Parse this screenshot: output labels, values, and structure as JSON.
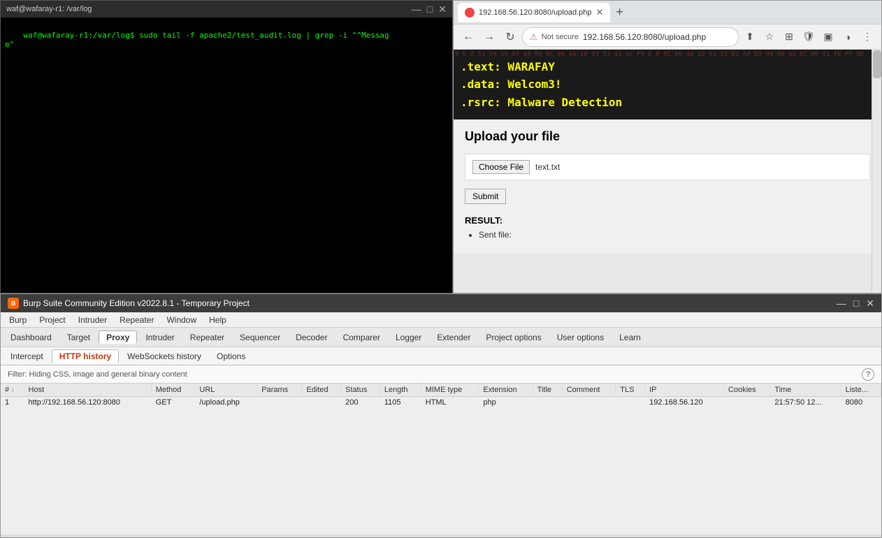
{
  "terminal": {
    "title": "waf@wafaray-r1: /var/log",
    "controls": [
      "—",
      "□",
      "✕"
    ],
    "content": "waf@wafaray-r1:/var/log$ sudo tail -f apache2/test_audit.log | grep -i \"^Messag\ne\""
  },
  "browser": {
    "tab_url": "192.168.56.120:8080/upload.php",
    "tab_close": "✕",
    "new_tab": "+",
    "nav": {
      "back": "←",
      "forward": "→",
      "refresh": "↻",
      "warning": "⚠",
      "not_secure": "Not secure",
      "address": "192.168.56.120:8080...",
      "share": "⬆",
      "bookmark": "☆",
      "extensions": "🧩",
      "profile": "◑",
      "menu": "⋮"
    },
    "hero": {
      "line1": ".text: WARAFAY",
      "line2": ".data: Welcom3!",
      "line3": ".rsrc: Malware Detection",
      "bg_numbers": "8 E 8 53 54 58 A3 48 06 8C 06 4A 10 93 53 43 6C F8 E 8 8C 06 4A 10 93 53 B2 A8 B3 04 A0 43 6C 00 01 FE FF 8D"
    },
    "page": {
      "title": "Upload your file",
      "choose_file_label": "Choose File",
      "filename": "text.txt",
      "submit_label": "Submit",
      "result_label": "RESULT:",
      "result_items": [
        "Sent file:"
      ]
    }
  },
  "burp": {
    "title": "Burp Suite Community Edition v2022.8.1 - Temporary Project",
    "logo": "B",
    "win_controls": [
      "—",
      "□",
      "✕"
    ],
    "menu": [
      "Burp",
      "Project",
      "Intruder",
      "Repeater",
      "Window",
      "Help"
    ],
    "toolbar": [
      "Dashboard",
      "Target",
      "Proxy",
      "Intruder",
      "Repeater",
      "Sequencer",
      "Decoder",
      "Comparer",
      "Logger",
      "Extender",
      "Project options",
      "User options",
      "Learn"
    ],
    "active_tool": "Proxy",
    "tabs": [
      "Intercept",
      "HTTP history",
      "WebSockets history",
      "Options"
    ],
    "active_tab": "HTTP history",
    "filter_text": "Filter: Hiding CSS, image and general binary content",
    "help_icon": "?",
    "table": {
      "columns": [
        "#",
        "Host",
        "Method",
        "URL",
        "Params",
        "Edited",
        "Status",
        "Length",
        "MIME type",
        "Extension",
        "Title",
        "Comment",
        "TLS",
        "IP",
        "Cookies",
        "Time",
        "Liste..."
      ],
      "rows": [
        {
          "num": "1",
          "host": "http://192.168.56.120:8080",
          "method": "GET",
          "url": "/upload.php",
          "params": "",
          "edited": "",
          "status": "200",
          "length": "1105",
          "mime_type": "HTML",
          "extension": "php",
          "title": "",
          "comment": "",
          "tls": "",
          "ip": "192.168.56.120",
          "cookies": "",
          "time": "21:57:50 12...",
          "listen": "8080"
        }
      ]
    }
  }
}
